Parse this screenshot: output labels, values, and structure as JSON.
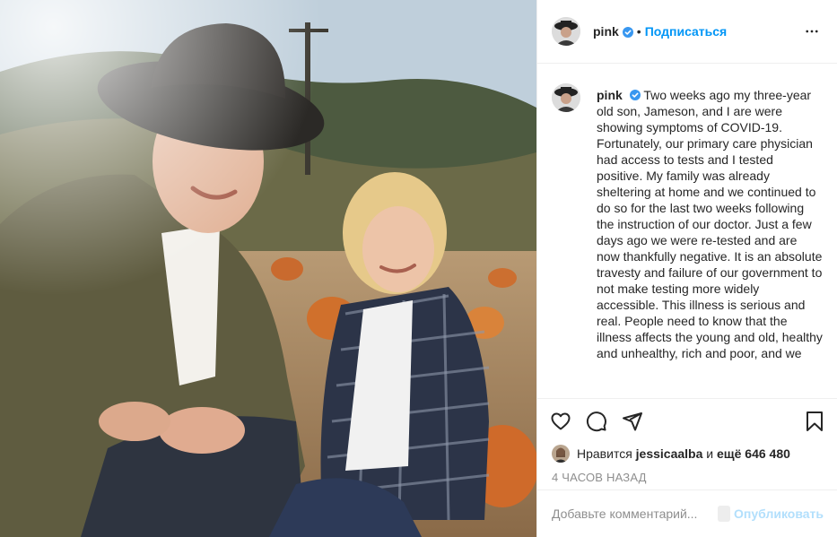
{
  "post": {
    "author": "pink",
    "follow_label": "Подписаться",
    "dot": "•",
    "caption_text": "Two weeks ago my three-year old son, Jameson, and I are were showing symptoms of COVID-19. Fortunately, our primary care physician had access to tests and I tested positive. My family was already sheltering at home and we continued to do so for the last two weeks following the instruction of our doctor. Just a few days ago we were re-tested and are now thankfully negative. It is an absolute travesty and failure of our government to not make testing more widely accessible. This illness is serious and real. People need to know that the illness affects the young and old, healthy and unhealthy, rich and poor, and we"
  },
  "likes": {
    "prefix": "Нравится",
    "liker": "jessicaalba",
    "joiner": "и",
    "others": "ещё 646 480"
  },
  "timestamp": "4 ЧАСОВ НАЗАД",
  "comment_box": {
    "placeholder": "Добавьте комментарий...",
    "publish_label": "Опубликовать"
  },
  "colors": {
    "accent": "#0095f6",
    "publish_disabled": "#b2dffc",
    "muted": "#8e8e8e"
  },
  "icons": [
    "verified-badge-icon",
    "more-options-icon",
    "heart-icon",
    "comment-icon",
    "share-icon",
    "bookmark-icon"
  ]
}
